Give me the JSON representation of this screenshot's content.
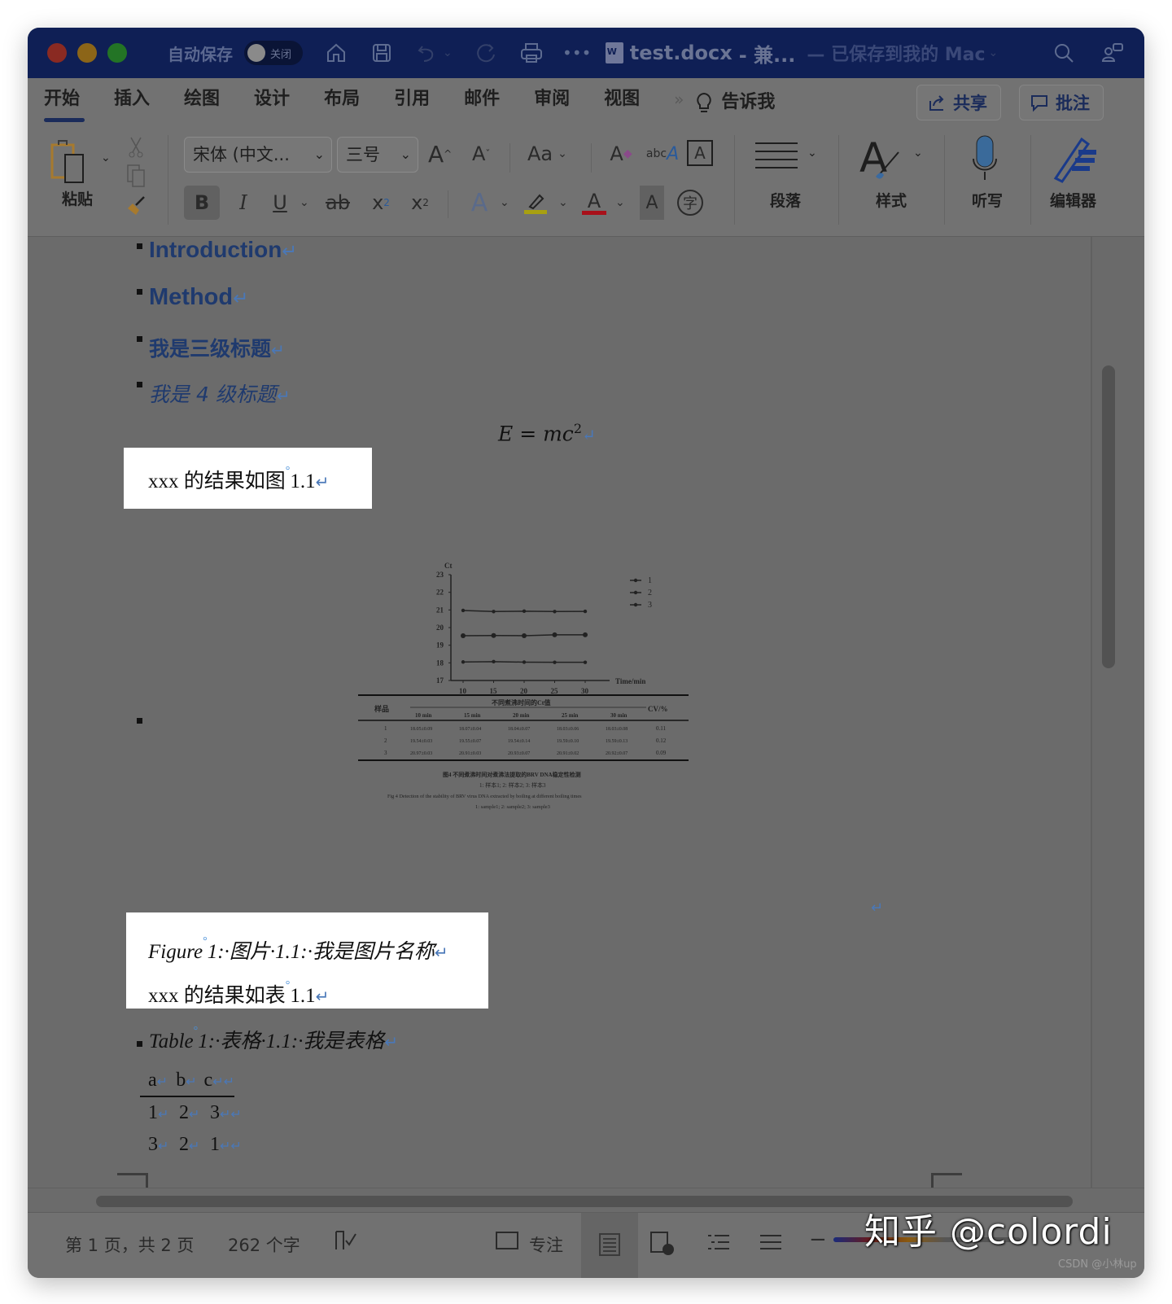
{
  "titlebar": {
    "autosave_label": "自动保存",
    "autosave_state": "关闭",
    "doc_name": "test.docx",
    "doc_mode": "- 兼...",
    "save_status": "— 已保存到我的 Mac"
  },
  "ribbon": {
    "tabs": [
      "开始",
      "插入",
      "绘图",
      "设计",
      "布局",
      "引用",
      "邮件",
      "审阅",
      "视图"
    ],
    "active_tab": "开始",
    "tab_more": "»",
    "tell_me": "告诉我",
    "share_label": "共享",
    "comment_label": "批注",
    "paste_label": "粘贴",
    "font_name": "宋体 (中文...",
    "font_size": "三号",
    "grow_font": "A",
    "shrink_font": "A",
    "change_case": "Aa",
    "bold": "B",
    "italic": "I",
    "underline": "U",
    "strikethrough": "ab",
    "subscript": "x",
    "superscript": "x",
    "paragraph_label": "段落",
    "styles_label": "样式",
    "dictate_label": "听写",
    "editor_label": "编辑器"
  },
  "document": {
    "headings": [
      {
        "level": 1,
        "text": "Introduction"
      },
      {
        "level": 2,
        "text": "Method"
      },
      {
        "level": 3,
        "text": "我是三级标题"
      },
      {
        "level": 4,
        "text": "我是 4 级标题"
      }
    ],
    "equation": "E = mc",
    "equation_power": "2",
    "figure_ref": "xxx 的结果如图",
    "figure_ref_num": "1.1",
    "figure_caption": "Figure",
    "figure_caption_rest": "1:·图片·1.1:·我是图片名称",
    "table_ref": "xxx 的结果如表",
    "table_ref_num": "1.1",
    "table_caption": "Table",
    "table_caption_rest": "1:·表格·1.1:·我是表格",
    "table": {
      "header": [
        "a",
        "b",
        "c"
      ],
      "rows": [
        [
          "1",
          "2",
          "3"
        ],
        [
          "3",
          "2",
          "1"
        ]
      ]
    },
    "para_mark": "↵"
  },
  "embedded_figure": {
    "y_label": "Ct",
    "x_label": "Time/min",
    "y_ticks": [
      "17",
      "18",
      "19",
      "20",
      "21",
      "22",
      "23"
    ],
    "x_ticks": [
      "10",
      "15",
      "20",
      "25",
      "30"
    ],
    "legend": [
      "1",
      "2",
      "3"
    ],
    "series": [
      {
        "name": "1",
        "values": [
          18.05,
          18.07,
          18.04,
          18.03,
          18.03
        ]
      },
      {
        "name": "2",
        "values": [
          19.54,
          19.55,
          19.54,
          19.59,
          19.59
        ]
      },
      {
        "name": "3",
        "values": [
          20.97,
          20.91,
          20.93,
          20.91,
          20.92
        ]
      }
    ],
    "table_header_group": "不同煮沸时间的Ct值",
    "table_col_sample": "样品",
    "table_col_cv": "CV/%",
    "table_cols": [
      "10 min",
      "15 min",
      "20 min",
      "25 min",
      "30 min"
    ],
    "table_rows": [
      {
        "sample": "1",
        "values": [
          "18.05±0.09",
          "18.07±0.04",
          "18.04±0.07",
          "18.03±0.06",
          "18.03±0.08"
        ],
        "cv": "0.11"
      },
      {
        "sample": "2",
        "values": [
          "19.54±0.03",
          "19.55±0.07",
          "19.54±0.14",
          "19.59±0.10",
          "19.59±0.13"
        ],
        "cv": "0.12"
      },
      {
        "sample": "3",
        "values": [
          "20.97±0.03",
          "20.91±0.03",
          "20.93±0.07",
          "20.91±0.02",
          "20.92±0.07"
        ],
        "cv": "0.09"
      }
    ],
    "caption_cn": "图4 不同煮沸时间对煮沸法提取的BRV DNA稳定性检测",
    "caption_cn_sub": "1: 样本1; 2: 样本2; 3: 样本3",
    "caption_en": "Fig 4 Detection of the stability of BRV virus DNA extracted by boiling at different boiling times",
    "caption_en_sub": "1: sample1; 2: sample2; 3: sample3"
  },
  "statusbar": {
    "page_info": "第 1 页，共 2 页",
    "word_count": "262 个字",
    "focus_label": "专注"
  },
  "watermark": "知乎 @colordi",
  "credit": "CSDN @小林up"
}
